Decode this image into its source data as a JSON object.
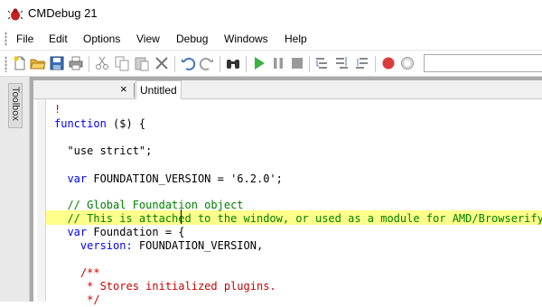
{
  "window": {
    "title": "CMDebug 21"
  },
  "menu": [
    "File",
    "Edit",
    "Options",
    "View",
    "Debug",
    "Windows",
    "Help"
  ],
  "toolbar": {
    "buttons": [
      "new-file",
      "open-folder",
      "save",
      "print",
      "cut",
      "copy",
      "paste",
      "delete",
      "undo",
      "redo",
      "find",
      "run",
      "pause",
      "stop",
      "step-into",
      "step-over",
      "step-out",
      "breakpoint",
      "clear-breakpoints"
    ],
    "combo_value": ""
  },
  "toolbox": {
    "label": "Toolbox"
  },
  "tabs": {
    "close_glyph": "×",
    "active_tab": "Untitled"
  },
  "editor": {
    "lines": [
      "!",
      "function ($) {",
      "",
      "  \"use strict\";",
      "",
      "  var FOUNDATION_VERSION = '6.2.0';",
      "",
      "  // Global Foundation object",
      "  // This is attached to the window, or used as a module for AMD/Browserify",
      "  var Foundation = {",
      "    version: FOUNDATION_VERSION,",
      "",
      "    /**",
      "     * Stores initialized plugins.",
      "     */"
    ],
    "highlighted_line": 9
  },
  "colors": {
    "keyword": "#0000ff",
    "comment": "#008000",
    "highlight": "#ffff8c",
    "doc_marker": "#cc0000"
  }
}
